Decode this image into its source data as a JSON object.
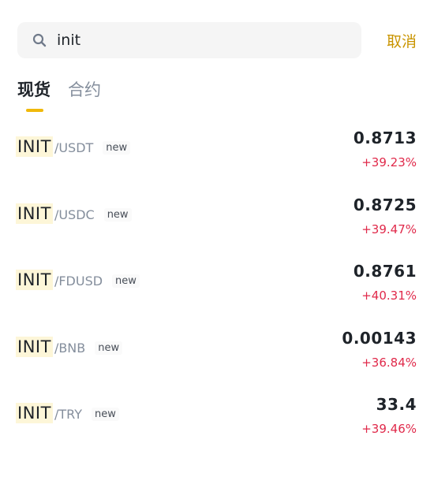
{
  "search": {
    "value": "init",
    "cancel_label": "取消"
  },
  "tabs": [
    {
      "label": "现货",
      "active": true
    },
    {
      "label": "合约",
      "active": false
    }
  ],
  "pairs": [
    {
      "base": "INIT",
      "quote": "/USDT",
      "badge": "new",
      "price": "0.8713",
      "change": "+39.23%"
    },
    {
      "base": "INIT",
      "quote": "/USDC",
      "badge": "new",
      "price": "0.8725",
      "change": "+39.47%"
    },
    {
      "base": "INIT",
      "quote": "/FDUSD",
      "badge": "new",
      "price": "0.8761",
      "change": "+40.31%"
    },
    {
      "base": "INIT",
      "quote": "/BNB",
      "badge": "new",
      "price": "0.00143",
      "change": "+36.84%"
    },
    {
      "base": "INIT",
      "quote": "/TRY",
      "badge": "new",
      "price": "33.4",
      "change": "+39.46%"
    }
  ],
  "colors": {
    "accent": "#f0b90b",
    "cancel": "#c99400",
    "positive_change": "#e0294a",
    "highlight": "#fdf6d8"
  },
  "icons": {
    "search": "search-icon"
  }
}
